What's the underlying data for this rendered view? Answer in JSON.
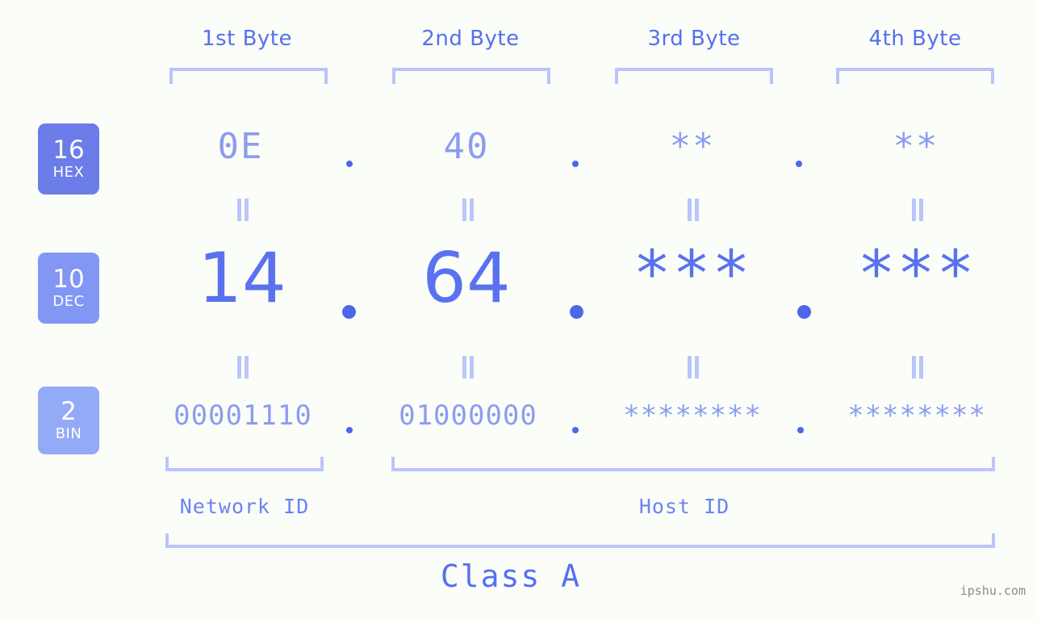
{
  "watermark": "ipshu.com",
  "colors": {
    "background": "#fbfdf9",
    "heading": "#5570ef",
    "bracket": "#b9c5fb",
    "value_light": "#8b9cf0",
    "value_strong": "#5a72ef",
    "dot": "#4d66ea",
    "badge_hex": "#6c7ce8",
    "badge_dec": "#8296f3",
    "badge_bin": "#93aaf7",
    "watermark": "#8a8a8a"
  },
  "byte_headers": [
    {
      "label": "1st Byte"
    },
    {
      "label": "2nd Byte"
    },
    {
      "label": "3rd Byte"
    },
    {
      "label": "4th Byte"
    }
  ],
  "rows": {
    "hex": {
      "badge_number": "16",
      "badge_name": "HEX",
      "values": [
        "0E",
        "40",
        "**",
        "**"
      ],
      "separator": "."
    },
    "dec": {
      "badge_number": "10",
      "badge_name": "DEC",
      "values": [
        "14",
        "64",
        "***",
        "***"
      ],
      "separator": "."
    },
    "bin": {
      "badge_number": "2",
      "badge_name": "BIN",
      "values": [
        "00001110",
        "01000000",
        "********",
        "********"
      ],
      "separator": "."
    }
  },
  "connectors": {
    "symbol": "="
  },
  "sections": [
    {
      "label": "Network ID"
    },
    {
      "label": "Host ID"
    }
  ],
  "class": {
    "label": "Class A"
  }
}
